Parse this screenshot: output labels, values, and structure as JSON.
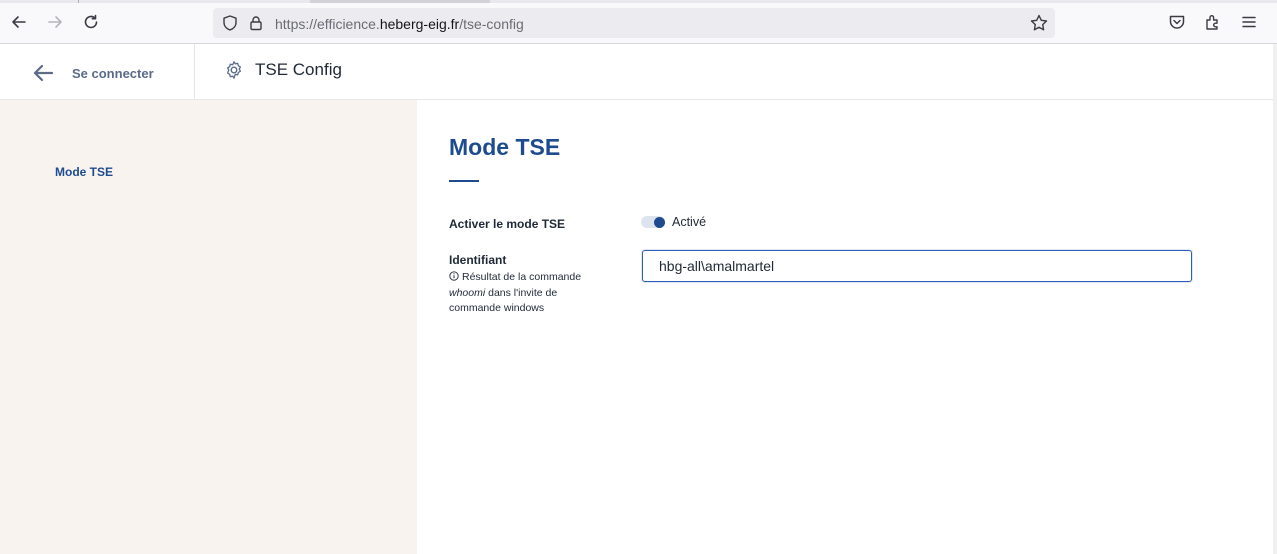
{
  "browser": {
    "url_prefix": "https://efficience.",
    "url_host": "heberg-eig.fr",
    "url_path": "/tse-config",
    "icons": [
      "back-arrow-icon",
      "forward-arrow-icon",
      "reload-icon",
      "shield-icon",
      "lock-icon",
      "bookmark-star-icon",
      "pocket-icon",
      "extensions-icon",
      "menu-icon"
    ]
  },
  "header": {
    "back_label": "Se connecter",
    "title": "TSE Config"
  },
  "sidebar": {
    "items": [
      {
        "label": "Mode TSE"
      }
    ]
  },
  "main": {
    "title": "Mode TSE",
    "tse_toggle": {
      "label": "Activer le mode TSE",
      "state_label": "Activé",
      "enabled": true
    },
    "identifier": {
      "label": "Identifiant",
      "hint_before": "Résultat de la commande",
      "hint_command": "whoomi",
      "hint_after": "dans l'invite de commande windows",
      "value": "hbg-all\\amalmartel"
    }
  },
  "colors": {
    "accent": "#1e4b8f",
    "sidebar_bg": "#f9f3ef",
    "input_border": "#2b5fb3"
  }
}
